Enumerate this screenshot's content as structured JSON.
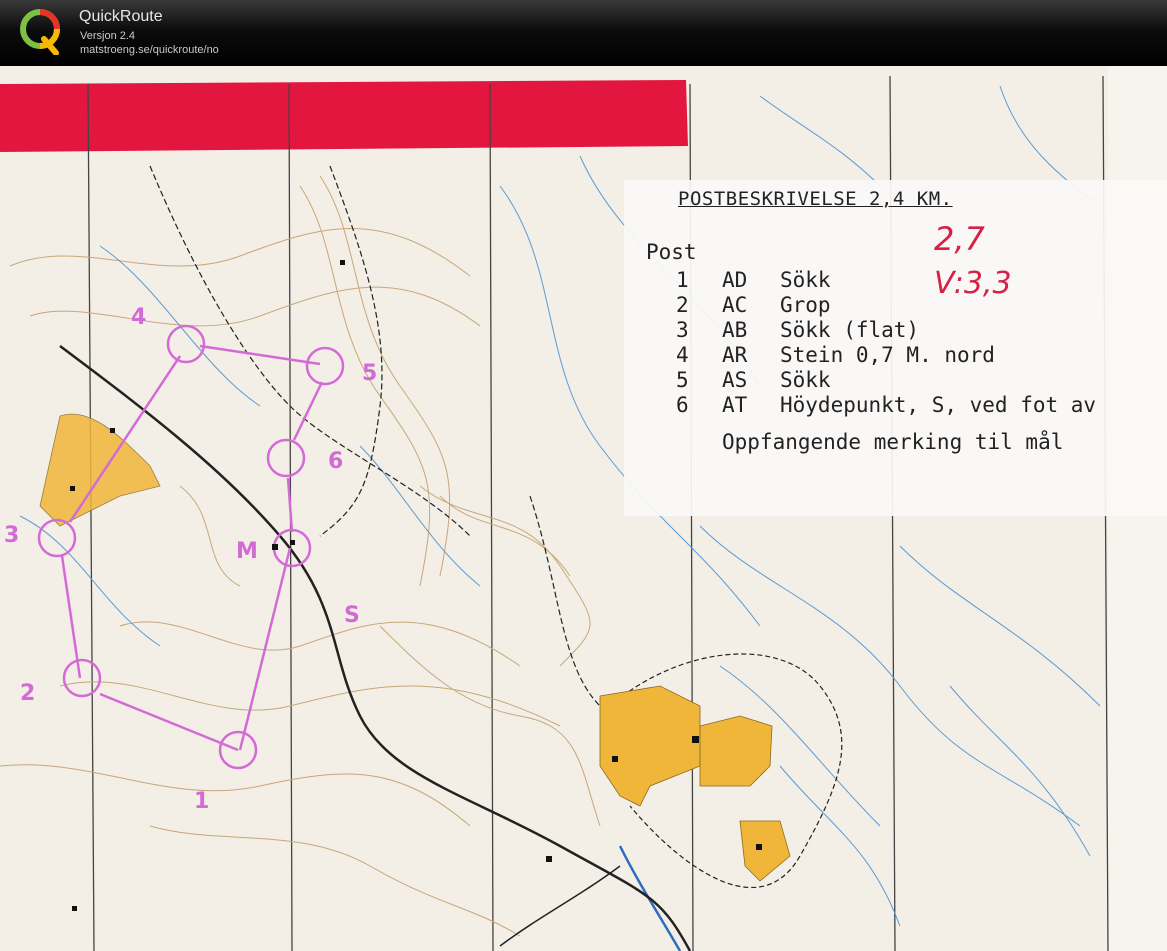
{
  "app": {
    "name": "QuickRoute",
    "version": "Versjon 2.4",
    "url": "matstroeng.se/quickroute/no",
    "logo_letter": "Q"
  },
  "map": {
    "legend": {
      "title": "POSTBESKRIVELSE  2,4 KM.",
      "handwritten_1": "2,7",
      "handwritten_2": "V:3,3",
      "post_heading": "Post",
      "rows": [
        {
          "num": "1",
          "code": "AD",
          "desc": "Sökk"
        },
        {
          "num": "2",
          "code": "AC",
          "desc": "Grop"
        },
        {
          "num": "3",
          "code": "AB",
          "desc": "Sökk (flat)"
        },
        {
          "num": "4",
          "code": "AR",
          "desc": "Stein 0,7 M. nord"
        },
        {
          "num": "5",
          "code": "AS",
          "desc": "Sökk"
        },
        {
          "num": "6",
          "code": "AT",
          "desc": "Höydepunkt, S, ved fot av"
        }
      ],
      "footer": "Oppfangende merking til mål"
    },
    "control_labels": [
      "1",
      "2",
      "3",
      "4",
      "5",
      "6",
      "M",
      "S"
    ],
    "colors": {
      "paper": "#f3efe6",
      "contour": "#c9a67a",
      "water": "#5b9bd5",
      "course": "#d46ad6",
      "settlement": "#f0b63a",
      "red_band": "#e3163f"
    }
  }
}
